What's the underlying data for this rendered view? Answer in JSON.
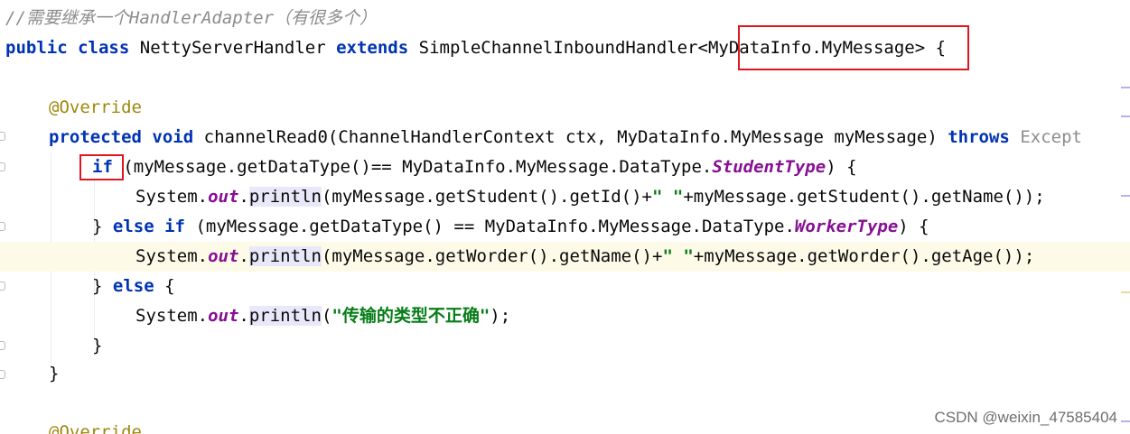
{
  "editor": {
    "lines": {
      "l1": {
        "comment": "//需要继承一个HandlerAdapter（有很多个）"
      },
      "l2": {
        "kw_public": "public",
        "kw_class": "class",
        "class_name": "NettyServerHandler",
        "kw_extends": "extends",
        "parent": "SimpleChannelInboundHandler<",
        "generic": "MyDataInfo.MyMessage",
        "close": "> {"
      },
      "l4": {
        "annotation": "@Override"
      },
      "l5": {
        "kw_protected": "protected",
        "kw_void": "void",
        "method": "channelRead0(ChannelHandlerContext ctx, MyDataInfo.MyMessage myMessage) ",
        "kw_throws": "throws",
        "exception": " Except"
      },
      "l6": {
        "kw_if": "if",
        "cond": " (myMessage.getDataType()== MyDataInfo.MyMessage.DataType.",
        "enum": "StudentType",
        "end": ") {"
      },
      "l7": {
        "sys": "System.",
        "out": "out",
        "dot": ".",
        "println": "println",
        "args1": "(myMessage.getStudent().getId()+",
        "str": "\" \"",
        "args2": "+myMessage.getStudent().getName());"
      },
      "l8": {
        "brace": "} ",
        "kw_else": "else",
        "kw_if": "if",
        "cond": " (myMessage.getDataType() == MyDataInfo.MyMessage.DataType.",
        "enum": "WorkerType",
        "end": ") {"
      },
      "l9": {
        "sys": "System.",
        "out": "out",
        "dot": ".",
        "println": "println",
        "args1": "(myMessage.getWorder().getName()+",
        "str": "\" \"",
        "args2": "+myMessage.getWorder().getAge());"
      },
      "l10": {
        "brace": "} ",
        "kw_else": "else",
        "end": " {"
      },
      "l11": {
        "sys": "System.",
        "out": "out",
        "dot": ".",
        "println": "println",
        "open": "(",
        "str": "\"传输的类型不正确\"",
        "close": ");"
      },
      "l12": {
        "brace": "}"
      },
      "l13": {
        "brace": "}"
      },
      "l15": {
        "annotation": "@Override"
      }
    }
  },
  "watermark": "CSDN @weixin_47585404",
  "colors": {
    "keyword": "#0033b3",
    "comment": "#8c8c8c",
    "annotation": "#9e880d",
    "field": "#871094",
    "string": "#067d17",
    "highlight_box": "#e0161f",
    "current_line": "#fdfbe8"
  }
}
